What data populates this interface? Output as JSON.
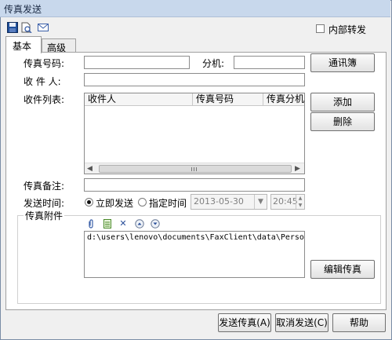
{
  "window": {
    "title": "传真发送"
  },
  "toolbar": {
    "icons": [
      "save-icon",
      "preview-icon",
      "email-icon"
    ]
  },
  "internal_forward": {
    "label": "内部转发",
    "checked": false
  },
  "tabs": {
    "basic": "基本",
    "advanced": "高级"
  },
  "form": {
    "fax_number_label": "传真号码:",
    "extension_label": "分机:",
    "recipient_label": "收 件 人:",
    "recipient_list_label": "收件列表:",
    "remark_label": "传真备注:",
    "send_time_label": "发送时间:",
    "send_now": "立即发送",
    "send_scheduled": "指定时间",
    "date_value": "2013-05-30",
    "time_value": "20:45",
    "attachment_group_label": "传真附件",
    "attachment_path": "d:\\users\\lenovo\\documents\\FaxClient\\data\\Person\\spo"
  },
  "recipient_table": {
    "columns": [
      "收件人",
      "传真号码",
      "传真分机"
    ]
  },
  "buttons": {
    "address_book": "通讯簿",
    "add": "添加",
    "delete": "删除",
    "edit_fax": "编辑传真",
    "send_fax": "发送传真(A)",
    "cancel_send": "取消发送(C)",
    "help": "帮助"
  },
  "colors": {
    "titlebar": "#c8d8ec",
    "window_bg": "#f0f0f0"
  }
}
